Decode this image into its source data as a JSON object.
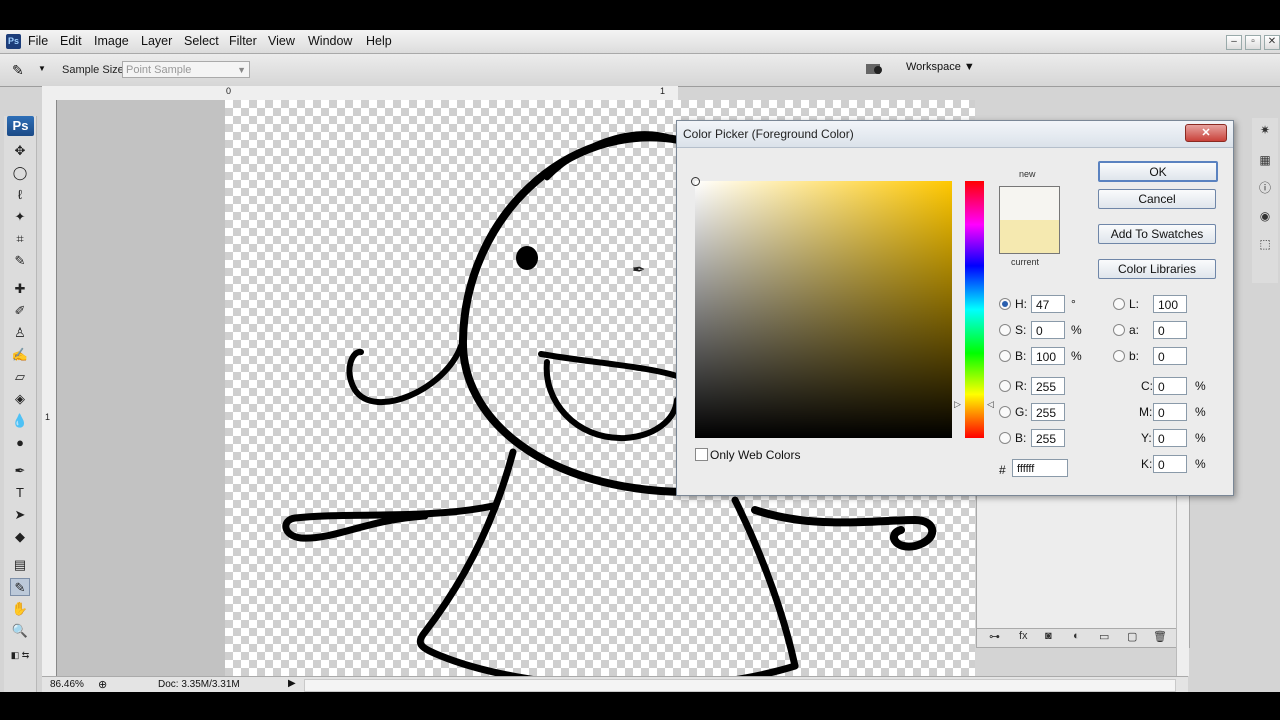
{
  "menubar": {
    "items": [
      "File",
      "Edit",
      "Image",
      "Layer",
      "Select",
      "Filter",
      "View",
      "Window",
      "Help"
    ],
    "window_controls": [
      "–",
      "▫",
      "✕"
    ]
  },
  "options": {
    "sample_size_label": "Sample Size:",
    "sample_size_value": "Point Sample",
    "workspace_label": "Workspace ▼"
  },
  "toolbox": {
    "logo": "Ps",
    "tools": [
      "move-icon",
      "marquee-icon",
      "lasso-icon",
      "magic-wand-icon",
      "crop-icon",
      "eyedropper-icon",
      "healing-brush-icon",
      "brush-icon",
      "clone-stamp-icon",
      "history-brush-icon",
      "eraser-icon",
      "paint-bucket-icon",
      "blur-icon",
      "dodge-icon",
      "pen-icon",
      "type-icon",
      "path-select-icon",
      "shape-icon",
      "notes-icon",
      "eyedropper-tool-icon",
      "hand-icon",
      "zoom-icon"
    ]
  },
  "rulers": {
    "top_zero": "0",
    "top_one": "1",
    "left_one": "1"
  },
  "status": {
    "zoom": "86.46%",
    "doc": "Doc: 3.35M/3.31M"
  },
  "dialog": {
    "title": "Color Picker (Foreground Color)",
    "close_label": "✕",
    "new_label": "new",
    "current_label": "current",
    "new_color": "#f6f5f1",
    "current_color": "#f5e9b0",
    "buttons": {
      "ok": "OK",
      "cancel": "Cancel",
      "add_swatches": "Add To Swatches",
      "color_libraries": "Color Libraries"
    },
    "hsb": {
      "h_label": "H:",
      "h": "47",
      "h_unit": "°",
      "s_label": "S:",
      "s": "0",
      "s_unit": "%",
      "b_label": "B:",
      "b": "100",
      "b_unit": "%"
    },
    "rgb": {
      "r_label": "R:",
      "r": "255",
      "g_label": "G:",
      "g": "255",
      "b_label": "B:",
      "b": "255"
    },
    "lab": {
      "l_label": "L:",
      "l": "100",
      "a_label": "a:",
      "a": "0",
      "b_label": "b:",
      "b": "0"
    },
    "cmyk": {
      "c_label": "C:",
      "c": "0",
      "m_label": "M:",
      "m": "0",
      "y_label": "Y:",
      "y": "0",
      "k_label": "K:",
      "k": "0",
      "unit": "%"
    },
    "only_web_colors": "Only Web Colors",
    "hex": "ffffff",
    "hash": "#"
  },
  "layers_footer": [
    "link-icon",
    "fx-icon",
    "mask-icon",
    "adjustment-icon",
    "folder-icon",
    "new-layer-icon",
    "trash-icon"
  ]
}
